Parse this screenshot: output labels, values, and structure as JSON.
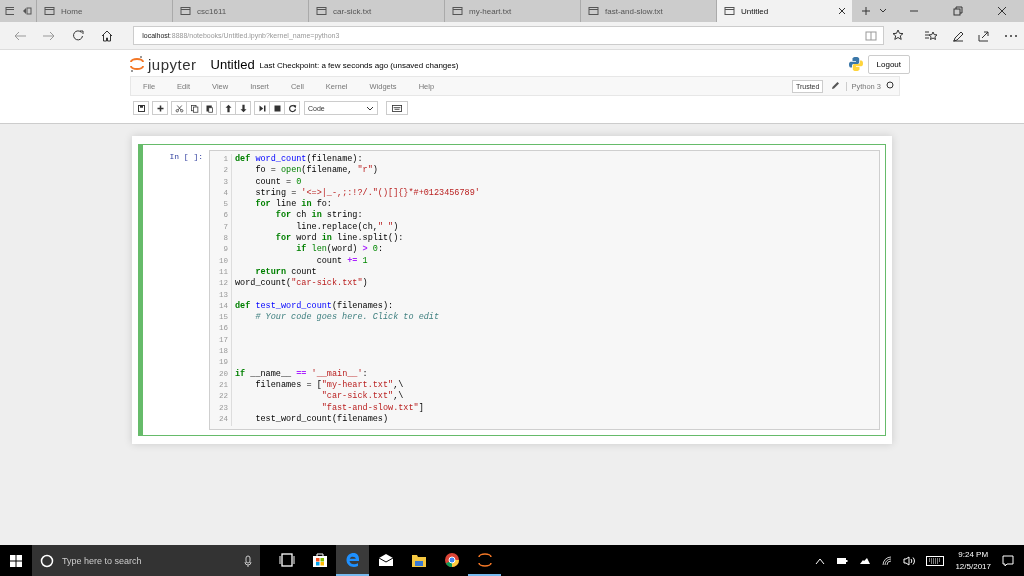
{
  "browser": {
    "tabs": [
      {
        "label": "Home",
        "selected": false
      },
      {
        "label": "csc1611",
        "selected": false
      },
      {
        "label": "car-sick.txt",
        "selected": false
      },
      {
        "label": "my-heart.txt",
        "selected": false
      },
      {
        "label": "fast-and-slow.txt",
        "selected": false
      },
      {
        "label": "Untitled",
        "selected": true
      }
    ],
    "address": {
      "host": "localhost",
      "rest": ":8888/notebooks/Untitled.ipynb?kernel_name=python3"
    }
  },
  "jupyter": {
    "logo_text": "jupyter",
    "notebook_name": "Untitled",
    "checkpoint": "Last Checkpoint: a few seconds ago (unsaved changes)",
    "logout": "Logout",
    "menu": [
      "File",
      "Edit",
      "View",
      "Insert",
      "Cell",
      "Kernel",
      "Widgets",
      "Help"
    ],
    "trusted": "Trusted",
    "kernel": "Python 3",
    "toolbar": [
      [
        {
          "kind": "save"
        }
      ],
      [
        {
          "kind": "plus"
        }
      ],
      [
        {
          "kind": "cut"
        },
        {
          "kind": "copy"
        },
        {
          "kind": "paste"
        }
      ],
      [
        {
          "kind": "up"
        },
        {
          "kind": "down"
        }
      ],
      [
        {
          "kind": "run"
        },
        {
          "kind": "stop"
        },
        {
          "kind": "restart"
        }
      ]
    ],
    "cell_type": "Code"
  },
  "cell": {
    "prompt": "In [ ]:",
    "lines": [
      {
        "number": "1",
        "text": "def word_count(filename):"
      },
      {
        "number": "2",
        "text": "    fo = open(filename, \"r\")"
      },
      {
        "number": "3",
        "text": "    count = 0"
      },
      {
        "number": "4",
        "text": "    string = '<=>|_-,;:!?/.\"()[]{}*#+0123456789'"
      },
      {
        "number": "5",
        "text": "    for line in fo:"
      },
      {
        "number": "6",
        "text": "        for ch in string:"
      },
      {
        "number": "7",
        "text": "            line.replace(ch,\" \")"
      },
      {
        "number": "8",
        "text": "        for word in line.split():"
      },
      {
        "number": "9",
        "text": "            if len(word) > 0:"
      },
      {
        "number": "10",
        "text": "                count += 1"
      },
      {
        "number": "11",
        "text": "    return count"
      },
      {
        "number": "12",
        "text": "word_count(\"car-sick.txt\")"
      },
      {
        "number": "13"
      },
      {
        "number": "14",
        "text": "def test_word_count(filenames):"
      },
      {
        "number": "15",
        "text": "    # Your code goes here. Click to edit"
      },
      {
        "number": "16"
      },
      {
        "number": "17"
      },
      {
        "number": "18"
      },
      {
        "number": "19"
      },
      {
        "number": "20",
        "text": "if __name__ == '__main__':"
      },
      {
        "number": "21",
        "text": "    filenames = [\"my-heart.txt\",\\"
      },
      {
        "number": "22",
        "text": "                 \"car-sick.txt\",\\"
      },
      {
        "number": "23",
        "text": "                 \"fast-and-slow.txt\"]"
      },
      {
        "number": "24",
        "text": "    test_word_count(filenames)"
      }
    ]
  },
  "taskbar": {
    "search_placeholder": "Type here to search",
    "apps": [
      {
        "kind": "taskview",
        "selected": false,
        "running": false
      },
      {
        "kind": "store",
        "selected": false,
        "running": false
      },
      {
        "kind": "edge",
        "selected": true,
        "running": true
      },
      {
        "kind": "mail",
        "selected": false,
        "running": false
      },
      {
        "kind": "folder",
        "selected": false,
        "running": false
      },
      {
        "kind": "chrome",
        "selected": false,
        "running": false
      },
      {
        "kind": "jupyter",
        "selected": false,
        "running": true
      }
    ],
    "time": "9:24 PM",
    "date": "12/5/2017"
  }
}
